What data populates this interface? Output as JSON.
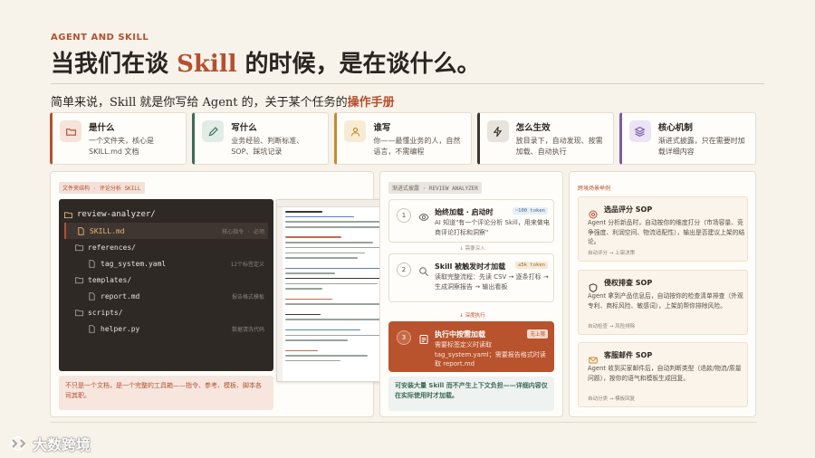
{
  "header": {
    "eyebrow": "AGENT AND SKILL",
    "title_pre": "当我们在谈 ",
    "title_hl": "Skill",
    "title_post": " 的时候，是在谈什么。",
    "subtitle_pre": "简单来说，Skill 就是你写给 Agent 的，关于某个任务的",
    "subtitle_hl": "操作手册"
  },
  "cards": [
    {
      "icon": "folder-icon",
      "title": "是什么",
      "desc": "一个文件夹，核心是 SKILL.md 文档",
      "color": "#b4502e",
      "bg": "#f6e3da"
    },
    {
      "icon": "pen-icon",
      "title": "写什么",
      "desc": "业务经验、判断标准、SOP、踩坑记录",
      "color": "#3e6a58",
      "bg": "#e2ece7"
    },
    {
      "icon": "person-icon",
      "title": "谁写",
      "desc": "你——最懂业务的人，自然语言，不需编程",
      "color": "#c58a2e",
      "bg": "#f7ebd3"
    },
    {
      "icon": "bolt-icon",
      "title": "怎么生效",
      "desc": "放目录下，自动发现、按需加载、自动执行",
      "color": "#3b3430",
      "bg": "#e8e3dd"
    },
    {
      "icon": "layers-icon",
      "title": "核心机制",
      "desc": "渐进式披露，只在需要时加载详细内容",
      "color": "#7b5aa6",
      "bg": "#ece4f4"
    }
  ],
  "panel1": {
    "tag": "文件夹结构 · 评论分析 SKILL",
    "tree": [
      {
        "name": "review-analyzer/",
        "note": "",
        "kind": "root"
      },
      {
        "name": "SKILL.md",
        "note": "核心指令 · 必须",
        "kind": "sel"
      },
      {
        "name": "references/",
        "note": "",
        "kind": "dir"
      },
      {
        "name": "tag_system.yaml",
        "note": "12个标签定义",
        "kind": "file"
      },
      {
        "name": "templates/",
        "note": "",
        "kind": "dir"
      },
      {
        "name": "report.md",
        "note": "报告格式模板",
        "kind": "file"
      },
      {
        "name": "scripts/",
        "note": "",
        "kind": "dir"
      },
      {
        "name": "helper.py",
        "note": "数据清洗代码",
        "kind": "file"
      }
    ],
    "note": "不只是一个文档，是一个完整的工具箱——指令、参考、模板、脚本各司其职。"
  },
  "panel2": {
    "tag": "渐进式披露 · REVIEW ANALYZER",
    "steps": [
      {
        "num": "1",
        "icon": "eye-icon",
        "title": "始终加载 · 启动时",
        "desc": "AI 知道\"有一个评论分析 Skill，用来做电商评论打标和洞察\"",
        "token": "~100 token"
      },
      {
        "num": "2",
        "icon": "search-icon",
        "title": "Skill 被触发时才加载",
        "desc": "读取完整流程：先读 CSV → 逐条打标 → 生成洞察报告 → 输出看板",
        "token": "≤5k token"
      },
      {
        "num": "3",
        "icon": "doc-icon",
        "title": "执行中按需加载",
        "desc": "需要标签定义时读取 tag_system.yaml；需要报告格式时读取 report.md",
        "token": "无上限"
      }
    ],
    "arrow1": "↓ 需要深入",
    "arrow2": "↓ 深度执行",
    "note": "可安装大量 Skill 而不产生上下文负担——详细内容仅在实际使用时才加载。"
  },
  "panel3": {
    "tag": "跨境场景举例",
    "sops": [
      {
        "icon": "target-icon",
        "title": "选品评分 SOP",
        "desc": "Agent 分析新品时，自动按你的维度打分（市场容量、竞争强度、利润空间、物流适配性），输出是否建议上架的结论。",
        "footer": "自动评分 → 上架决策"
      },
      {
        "icon": "shield-icon",
        "title": "侵权排查 SOP",
        "desc": "Agent 拿到产品信息后，自动按你的检查清单排查（外观专利、商标风险、敏感词），上架前帮你排除风险。",
        "footer": "自动检查 → 风险排除"
      },
      {
        "icon": "mail-icon",
        "title": "客服邮件 SOP",
        "desc": "Agent 收到买家邮件后，自动判断类型（退款/物流/质量问题），按你的语气和模板生成回复。",
        "footer": "自动分类 → 模板回复"
      }
    ]
  },
  "brand": {
    "logo_text": "大数跨境"
  }
}
